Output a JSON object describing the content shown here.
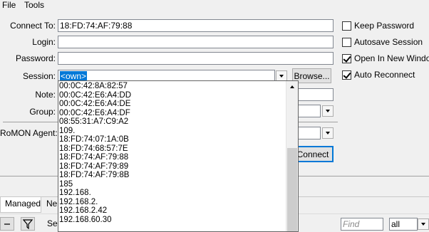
{
  "menu": {
    "file": "File",
    "tools": "Tools"
  },
  "form": {
    "connect_to_label": "Connect To:",
    "connect_to_value": "18:FD:74:AF:79:88",
    "login_label": "Login:",
    "login_value": "",
    "password_label": "Password:",
    "session_label": "Session:",
    "session_value": "<own>",
    "browse_label": "Browse...",
    "note_label": "Note:",
    "group_label": "Group:",
    "romon_agent_label": "RoMON Agent:",
    "connect_label": "Connect"
  },
  "options": {
    "keep_password": {
      "label": "Keep Password",
      "checked": false
    },
    "autosave_session": {
      "label": "Autosave Session",
      "checked": false
    },
    "open_in_new_window": {
      "label": "Open In New Window",
      "checked": true
    },
    "auto_reconnect": {
      "label": "Auto Reconnect",
      "checked": true
    }
  },
  "session_dropdown": {
    "items": [
      "00:0C:42:8A:82:57",
      "00:0C:42:E6:A4:DD",
      "00:0C:42:E6:A4:DE",
      "00:0C:42:E6:A4:DF",
      "08:55:31:A7:C9:A2",
      "109.",
      "18:FD:74:07:1A:0B",
      "18:FD:74:68:57:7E",
      "18:FD:74:AF:79:88",
      "18:FD:74:AF:79:89",
      "18:FD:74:AF:79:8B",
      "185",
      "192.168.",
      "192.168.2.",
      "192.168.2.42",
      "192.168.60.30"
    ]
  },
  "bottom": {
    "tabs": [
      "Managed",
      "Nei"
    ],
    "set_label": "Se",
    "find_placeholder": "Find",
    "filter_value": "all"
  }
}
